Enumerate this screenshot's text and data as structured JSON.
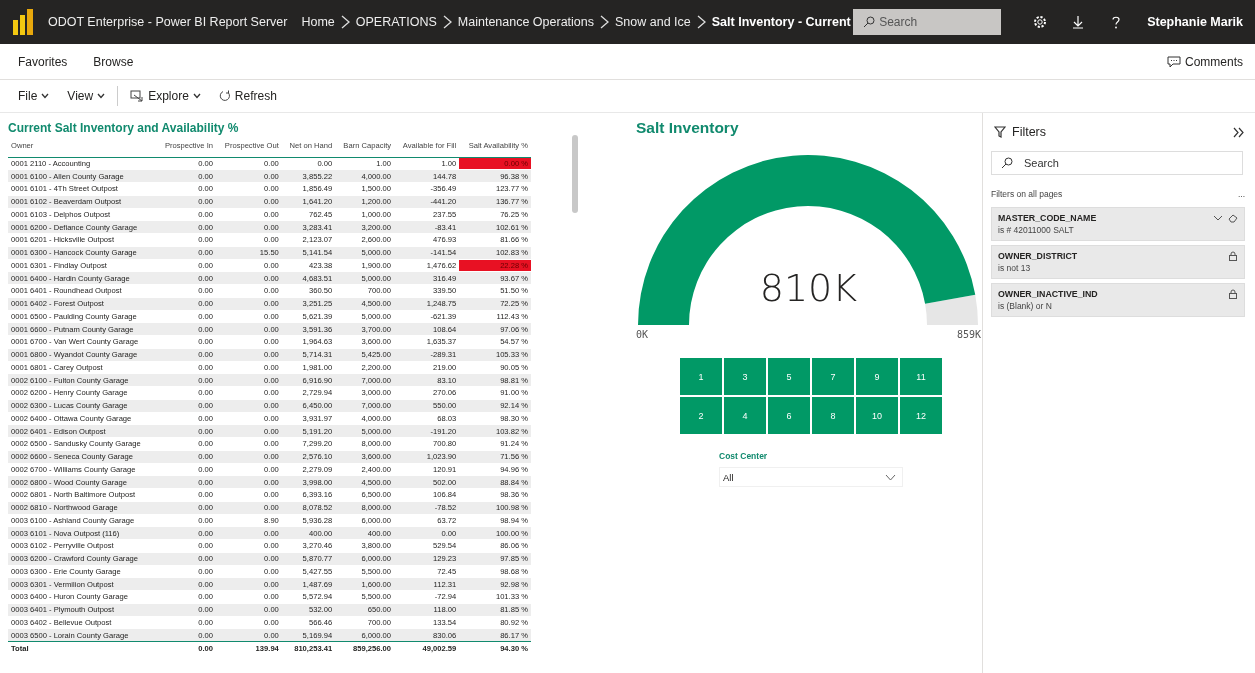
{
  "header": {
    "app_title": "ODOT Enterprise - Power BI Report Server",
    "breadcrumbs": [
      {
        "label": "Home",
        "current": false
      },
      {
        "label": "OPERATIONS",
        "current": false
      },
      {
        "label": "Maintenance Operations",
        "current": false
      },
      {
        "label": "Snow and Ice",
        "current": false
      },
      {
        "label": "Salt Inventory - Current",
        "current": true
      }
    ],
    "search": {
      "placeholder": "Search"
    },
    "user": "Stephanie Marik"
  },
  "nav": {
    "items": [
      "Favorites",
      "Browse"
    ],
    "comments": "Comments"
  },
  "toolbar": [
    {
      "label": "File",
      "kind": "menu"
    },
    {
      "label": "View",
      "kind": "menu"
    },
    {
      "label": "Explore",
      "kind": "explore"
    },
    {
      "label": "Refresh",
      "kind": "refresh"
    }
  ],
  "table": {
    "title": "Current Salt Inventory and Availability %",
    "columns": [
      "Owner",
      "Prospective In",
      "Prospective Out",
      "Net on Hand",
      "Barn Capacity",
      "Available for Fill",
      "Salt Availability %"
    ],
    "rows": [
      {
        "cells": [
          "0001 2110 - Accounting",
          "0.00",
          "0.00",
          "0.00",
          "1.00",
          "1.00",
          "0.00 %"
        ],
        "alert": true
      },
      {
        "cells": [
          "0001 6100 - Allen County Garage",
          "0.00",
          "0.00",
          "3,855.22",
          "4,000.00",
          "144.78",
          "96.38 %"
        ],
        "alert": false
      },
      {
        "cells": [
          "0001 6101 - 4Th Street Outpost",
          "0.00",
          "0.00",
          "1,856.49",
          "1,500.00",
          "-356.49",
          "123.77 %"
        ],
        "alert": false
      },
      {
        "cells": [
          "0001 6102 - Beaverdam Outpost",
          "0.00",
          "0.00",
          "1,641.20",
          "1,200.00",
          "-441.20",
          "136.77 %"
        ],
        "alert": false
      },
      {
        "cells": [
          "0001 6103 - Delphos Outpost",
          "0.00",
          "0.00",
          "762.45",
          "1,000.00",
          "237.55",
          "76.25 %"
        ],
        "alert": false
      },
      {
        "cells": [
          "0001 6200 - Defiance County Garage",
          "0.00",
          "0.00",
          "3,283.41",
          "3,200.00",
          "-83.41",
          "102.61 %"
        ],
        "alert": false
      },
      {
        "cells": [
          "0001 6201 - Hicksville Outpost",
          "0.00",
          "0.00",
          "2,123.07",
          "2,600.00",
          "476.93",
          "81.66 %"
        ],
        "alert": false
      },
      {
        "cells": [
          "0001 6300 - Hancock County Garage",
          "0.00",
          "15.50",
          "5,141.54",
          "5,000.00",
          "-141.54",
          "102.83 %"
        ],
        "alert": false
      },
      {
        "cells": [
          "0001 6301 - Findlay Outpost",
          "0.00",
          "0.00",
          "423.38",
          "1,900.00",
          "1,476.62",
          "22.28 %"
        ],
        "alert": true
      },
      {
        "cells": [
          "0001 6400 - Hardin County Garage",
          "0.00",
          "0.00",
          "4,683.51",
          "5,000.00",
          "316.49",
          "93.67 %"
        ],
        "alert": false
      },
      {
        "cells": [
          "0001 6401 - Roundhead Outpost",
          "0.00",
          "0.00",
          "360.50",
          "700.00",
          "339.50",
          "51.50 %"
        ],
        "alert": false
      },
      {
        "cells": [
          "0001 6402 - Forest Outpost",
          "0.00",
          "0.00",
          "3,251.25",
          "4,500.00",
          "1,248.75",
          "72.25 %"
        ],
        "alert": false
      },
      {
        "cells": [
          "0001 6500 - Paulding County Garage",
          "0.00",
          "0.00",
          "5,621.39",
          "5,000.00",
          "-621.39",
          "112.43 %"
        ],
        "alert": false
      },
      {
        "cells": [
          "0001 6600 - Putnam County Garage",
          "0.00",
          "0.00",
          "3,591.36",
          "3,700.00",
          "108.64",
          "97.06 %"
        ],
        "alert": false
      },
      {
        "cells": [
          "0001 6700 - Van Wert County Garage",
          "0.00",
          "0.00",
          "1,964.63",
          "3,600.00",
          "1,635.37",
          "54.57 %"
        ],
        "alert": false
      },
      {
        "cells": [
          "0001 6800 - Wyandot County Garage",
          "0.00",
          "0.00",
          "5,714.31",
          "5,425.00",
          "-289.31",
          "105.33 %"
        ],
        "alert": false
      },
      {
        "cells": [
          "0001 6801 - Carey Outpost",
          "0.00",
          "0.00",
          "1,981.00",
          "2,200.00",
          "219.00",
          "90.05 %"
        ],
        "alert": false
      },
      {
        "cells": [
          "0002 6100 - Fulton County Garage",
          "0.00",
          "0.00",
          "6,916.90",
          "7,000.00",
          "83.10",
          "98.81 %"
        ],
        "alert": false
      },
      {
        "cells": [
          "0002 6200 - Henry County Garage",
          "0.00",
          "0.00",
          "2,729.94",
          "3,000.00",
          "270.06",
          "91.00 %"
        ],
        "alert": false
      },
      {
        "cells": [
          "0002 6300 - Lucas County Garage",
          "0.00",
          "0.00",
          "6,450.00",
          "7,000.00",
          "550.00",
          "92.14 %"
        ],
        "alert": false
      },
      {
        "cells": [
          "0002 6400 - Ottawa County Garage",
          "0.00",
          "0.00",
          "3,931.97",
          "4,000.00",
          "68.03",
          "98.30 %"
        ],
        "alert": false
      },
      {
        "cells": [
          "0002 6401 - Edison Outpost",
          "0.00",
          "0.00",
          "5,191.20",
          "5,000.00",
          "-191.20",
          "103.82 %"
        ],
        "alert": false
      },
      {
        "cells": [
          "0002 6500 - Sandusky County Garage",
          "0.00",
          "0.00",
          "7,299.20",
          "8,000.00",
          "700.80",
          "91.24 %"
        ],
        "alert": false
      },
      {
        "cells": [
          "0002 6600 - Seneca County Garage",
          "0.00",
          "0.00",
          "2,576.10",
          "3,600.00",
          "1,023.90",
          "71.56 %"
        ],
        "alert": false
      },
      {
        "cells": [
          "0002 6700 - Williams County Garage",
          "0.00",
          "0.00",
          "2,279.09",
          "2,400.00",
          "120.91",
          "94.96 %"
        ],
        "alert": false
      },
      {
        "cells": [
          "0002 6800 - Wood County Garage",
          "0.00",
          "0.00",
          "3,998.00",
          "4,500.00",
          "502.00",
          "88.84 %"
        ],
        "alert": false
      },
      {
        "cells": [
          "0002 6801 - North Baltimore Outpost",
          "0.00",
          "0.00",
          "6,393.16",
          "6,500.00",
          "106.84",
          "98.36 %"
        ],
        "alert": false
      },
      {
        "cells": [
          "0002 6810 - Northwood Garage",
          "0.00",
          "0.00",
          "8,078.52",
          "8,000.00",
          "-78.52",
          "100.98 %"
        ],
        "alert": false
      },
      {
        "cells": [
          "0003 6100 - Ashland County Garage",
          "0.00",
          "8.90",
          "5,936.28",
          "6,000.00",
          "63.72",
          "98.94 %"
        ],
        "alert": false
      },
      {
        "cells": [
          "0003 6101 - Nova Outpost (116)",
          "0.00",
          "0.00",
          "400.00",
          "400.00",
          "0.00",
          "100.00 %"
        ],
        "alert": false
      },
      {
        "cells": [
          "0003 6102 - Perryville Outpost",
          "0.00",
          "0.00",
          "3,270.46",
          "3,800.00",
          "529.54",
          "86.06 %"
        ],
        "alert": false
      },
      {
        "cells": [
          "0003 6200 - Crawford County Garage",
          "0.00",
          "0.00",
          "5,870.77",
          "6,000.00",
          "129.23",
          "97.85 %"
        ],
        "alert": false
      },
      {
        "cells": [
          "0003 6300 - Erie County Garage",
          "0.00",
          "0.00",
          "5,427.55",
          "5,500.00",
          "72.45",
          "98.68 %"
        ],
        "alert": false
      },
      {
        "cells": [
          "0003 6301 - Vermilion Outpost",
          "0.00",
          "0.00",
          "1,487.69",
          "1,600.00",
          "112.31",
          "92.98 %"
        ],
        "alert": false
      },
      {
        "cells": [
          "0003 6400 - Huron County Garage",
          "0.00",
          "0.00",
          "5,572.94",
          "5,500.00",
          "-72.94",
          "101.33 %"
        ],
        "alert": false
      },
      {
        "cells": [
          "0003 6401 - Plymouth Outpost",
          "0.00",
          "0.00",
          "532.00",
          "650.00",
          "118.00",
          "81.85 %"
        ],
        "alert": false
      },
      {
        "cells": [
          "0003 6402 - Bellevue Outpost",
          "0.00",
          "0.00",
          "566.46",
          "700.00",
          "133.54",
          "80.92 %"
        ],
        "alert": false
      },
      {
        "cells": [
          "0003 6500 - Lorain County Garage",
          "0.00",
          "0.00",
          "5,169.94",
          "6,000.00",
          "830.06",
          "86.17 %"
        ],
        "alert": false
      }
    ],
    "total": [
      "Total",
      "0.00",
      "139.94",
      "810,253.41",
      "859,256.00",
      "49,002.59",
      "94.30 %"
    ]
  },
  "gauge": {
    "title": "Salt Inventory",
    "value": "810K",
    "min": "0K",
    "max": "859K",
    "level": 0.943
  },
  "slicer": {
    "tiles": [
      {
        "label": "1",
        "selected": true
      },
      {
        "label": "3",
        "selected": true
      },
      {
        "label": "5",
        "selected": true
      },
      {
        "label": "7",
        "selected": true
      },
      {
        "label": "9",
        "selected": true
      },
      {
        "label": "11",
        "selected": true
      },
      {
        "label": "2",
        "selected": true
      },
      {
        "label": "4",
        "selected": true
      },
      {
        "label": "6",
        "selected": true
      },
      {
        "label": "8",
        "selected": true
      },
      {
        "label": "10",
        "selected": true
      },
      {
        "label": "12",
        "selected": true
      }
    ]
  },
  "cost_center": {
    "label": "Cost Center",
    "value": "All"
  },
  "filters": {
    "title": "Filters",
    "search": {
      "placeholder": "Search"
    },
    "section": "Filters on all pages",
    "more": "...",
    "cards": [
      {
        "name": "MASTER_CODE_NAME",
        "condition": "is # 42011000 SALT",
        "locked": false
      },
      {
        "name": "OWNER_DISTRICT",
        "condition": "is not 13",
        "locked": true
      },
      {
        "name": "OWNER_INACTIVE_IND",
        "condition": "is (Blank) or N",
        "locked": true
      }
    ]
  }
}
